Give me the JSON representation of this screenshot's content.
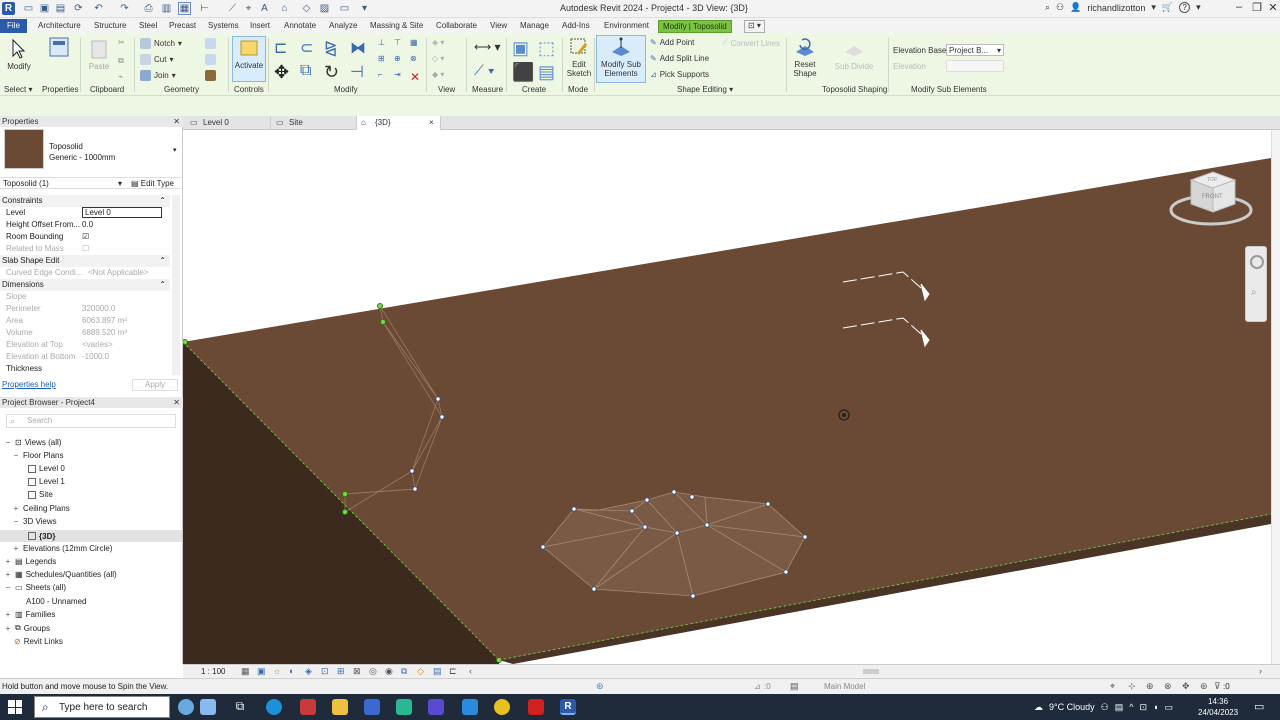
{
  "title_bar": {
    "app_title": "Autodesk Revit 2024 - Project4 - 3D View: {3D}",
    "user_name": "richandlizotton",
    "user_caret": "▾",
    "help": "?",
    "help_caret": "▾"
  },
  "ribbon_tabs": [
    "File",
    "Architecture",
    "Structure",
    "Steel",
    "Precast",
    "Systems",
    "Insert",
    "Annotate",
    "Analyze",
    "Massing & Site",
    "Collaborate",
    "View",
    "Manage",
    "Add-Ins",
    "Environment",
    "Modify | Toposolid"
  ],
  "ribbon": {
    "modify_label": "Modify",
    "select_label": "Select",
    "select_caret": "▾",
    "properties_label": "Properties",
    "clipboard_label": "Clipboard",
    "paste_label": "Paste",
    "geometry": {
      "notch": "Notch",
      "cut": "Cut",
      "join": "Join",
      "label": "Geometry"
    },
    "activate_label": "Activate",
    "controls_label": "Controls",
    "modify_panel_label": "Modify",
    "view_label": "View",
    "measure_label": "Measure",
    "create_label": "Create",
    "edit_sketch_label": "Edit Sketch",
    "mode_label": "Mode",
    "modify_sub_label": "Modify Sub Elements",
    "add_point": "Add Point",
    "add_split_line": "Add Split Line",
    "pick_supports": "Pick Supports",
    "convert_lines": "Convert Lines",
    "shape_editing_label": "Shape Editing",
    "shape_editing_caret": "▾",
    "reset_shape_label": "Reset Shape",
    "sub_divide_label": "Sub Divide",
    "toposolid_shaping_label": "Toposolid Shaping",
    "elevation_base_label": "Elevation Base:",
    "elevation_base_value": "Project B...",
    "elevation_label": "Elevation",
    "modify_sub_elements_panel": "Modify Sub Elements"
  },
  "properties": {
    "header": "Properties",
    "type_name": "Toposolid",
    "type_sub": "Generic - 1000mm",
    "instance_selector": "Toposolid (1)",
    "edit_type": "Edit Type",
    "sections": {
      "constraints": "Constraints",
      "slab_shape_edit": "Slab Shape Edit",
      "dimensions": "Dimensions"
    },
    "rows": {
      "level": {
        "k": "Level",
        "v": "Level 0"
      },
      "height_offset": {
        "k": "Height Offset From...",
        "v": "0.0"
      },
      "room_bounding": {
        "k": "Room Bounding",
        "v": "☑"
      },
      "related_to_mass": {
        "k": "Related to Mass",
        "v": "☐"
      },
      "curved_edge": {
        "k": "Curved Edge Condi...",
        "v": "<Not Applicable>"
      },
      "slope": {
        "k": "Slope",
        "v": ""
      },
      "perimeter": {
        "k": "Perimeter",
        "v": "320000.0"
      },
      "area": {
        "k": "Area",
        "v": "6063.897 m²"
      },
      "volume": {
        "k": "Volume",
        "v": "6889.520 m³"
      },
      "elev_top": {
        "k": "Elevation at Top",
        "v": "<varies>"
      },
      "elev_bottom": {
        "k": "Elevation at Bottom",
        "v": "-1000.0"
      },
      "thickness": {
        "k": "Thickness",
        "v": ""
      }
    },
    "help_link": "Properties help",
    "apply": "Apply"
  },
  "project_browser": {
    "header": "Project Browser - Project4",
    "search_placeholder": "Search",
    "items": {
      "views_all": "Views (all)",
      "floor_plans": "Floor Plans",
      "level0": "Level 0",
      "level1": "Level 1",
      "site": "Site",
      "ceiling_plans": "Ceiling Plans",
      "views_3d": "3D Views",
      "view_3d": "{3D}",
      "elevations": "Elevations (12mm Circle)",
      "legends": "Legends",
      "schedules": "Schedules/Quantities (all)",
      "sheets": "Sheets (all)",
      "sheet_a100": "A100 - Unnamed",
      "families": "Families",
      "groups": "Groups",
      "revit_links": "Revit Links"
    }
  },
  "doc_tabs": {
    "level0": "Level 0",
    "site": "Site",
    "view3d": "{3D}",
    "close": "×"
  },
  "viewcube": {
    "face": "FRONT",
    "top": "TOP"
  },
  "view_bar": {
    "scale": "1 : 100"
  },
  "status": {
    "message": "Hold button and move mouse to Spin the View.",
    "workset": ":0",
    "model": "Main Model",
    "filter": ":0"
  },
  "taskbar": {
    "search_placeholder": "Type here to search",
    "weather": "9°C  Cloudy",
    "time": "14:36",
    "date": "24/04/2023"
  },
  "colors": {
    "ribbon_bg": "#eef6e4",
    "context_tab": "#7cc243",
    "file_tab": "#2a5aa8",
    "toposolid_top": "#6b4a35",
    "toposolid_side": "#3d2a1e",
    "toposolid_front": "#4a3426"
  }
}
